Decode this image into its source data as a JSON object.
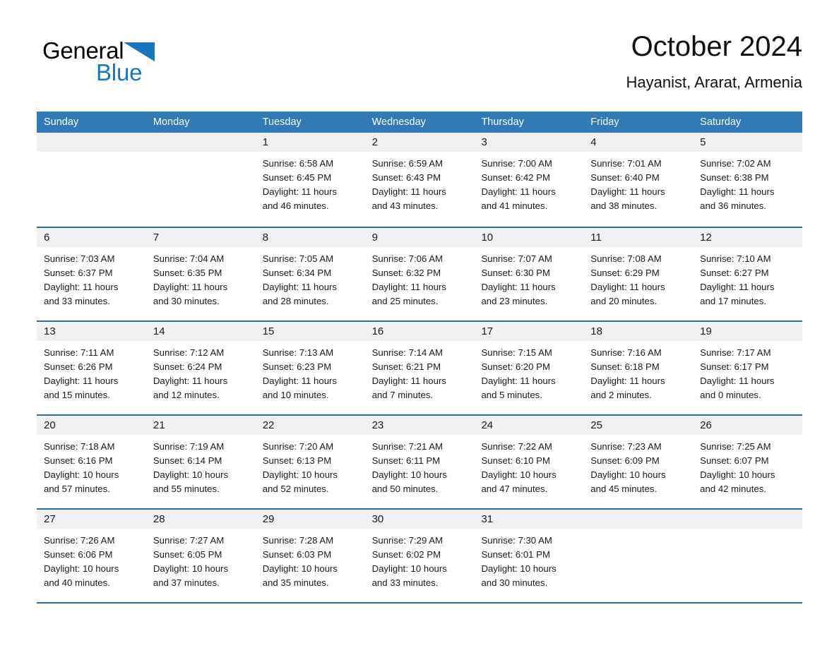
{
  "brand": {
    "name_part1": "General",
    "name_part2": "Blue",
    "triangle_color": "#1a76bc",
    "accent_color": "#3279b7"
  },
  "header": {
    "month_title": "October 2024",
    "location": "Hayanist, Ararat, Armenia"
  },
  "calendar": {
    "weekday_headers": [
      "Sunday",
      "Monday",
      "Tuesday",
      "Wednesday",
      "Thursday",
      "Friday",
      "Saturday"
    ],
    "weeks": [
      [
        {
          "day": "",
          "sunrise": "",
          "sunset": "",
          "daylight_line1": "",
          "daylight_line2": "",
          "empty": true
        },
        {
          "day": "",
          "sunrise": "",
          "sunset": "",
          "daylight_line1": "",
          "daylight_line2": "",
          "empty": true
        },
        {
          "day": "1",
          "sunrise": "Sunrise: 6:58 AM",
          "sunset": "Sunset: 6:45 PM",
          "daylight_line1": "Daylight: 11 hours",
          "daylight_line2": "and 46 minutes."
        },
        {
          "day": "2",
          "sunrise": "Sunrise: 6:59 AM",
          "sunset": "Sunset: 6:43 PM",
          "daylight_line1": "Daylight: 11 hours",
          "daylight_line2": "and 43 minutes."
        },
        {
          "day": "3",
          "sunrise": "Sunrise: 7:00 AM",
          "sunset": "Sunset: 6:42 PM",
          "daylight_line1": "Daylight: 11 hours",
          "daylight_line2": "and 41 minutes."
        },
        {
          "day": "4",
          "sunrise": "Sunrise: 7:01 AM",
          "sunset": "Sunset: 6:40 PM",
          "daylight_line1": "Daylight: 11 hours",
          "daylight_line2": "and 38 minutes."
        },
        {
          "day": "5",
          "sunrise": "Sunrise: 7:02 AM",
          "sunset": "Sunset: 6:38 PM",
          "daylight_line1": "Daylight: 11 hours",
          "daylight_line2": "and 36 minutes."
        }
      ],
      [
        {
          "day": "6",
          "sunrise": "Sunrise: 7:03 AM",
          "sunset": "Sunset: 6:37 PM",
          "daylight_line1": "Daylight: 11 hours",
          "daylight_line2": "and 33 minutes."
        },
        {
          "day": "7",
          "sunrise": "Sunrise: 7:04 AM",
          "sunset": "Sunset: 6:35 PM",
          "daylight_line1": "Daylight: 11 hours",
          "daylight_line2": "and 30 minutes."
        },
        {
          "day": "8",
          "sunrise": "Sunrise: 7:05 AM",
          "sunset": "Sunset: 6:34 PM",
          "daylight_line1": "Daylight: 11 hours",
          "daylight_line2": "and 28 minutes."
        },
        {
          "day": "9",
          "sunrise": "Sunrise: 7:06 AM",
          "sunset": "Sunset: 6:32 PM",
          "daylight_line1": "Daylight: 11 hours",
          "daylight_line2": "and 25 minutes."
        },
        {
          "day": "10",
          "sunrise": "Sunrise: 7:07 AM",
          "sunset": "Sunset: 6:30 PM",
          "daylight_line1": "Daylight: 11 hours",
          "daylight_line2": "and 23 minutes."
        },
        {
          "day": "11",
          "sunrise": "Sunrise: 7:08 AM",
          "sunset": "Sunset: 6:29 PM",
          "daylight_line1": "Daylight: 11 hours",
          "daylight_line2": "and 20 minutes."
        },
        {
          "day": "12",
          "sunrise": "Sunrise: 7:10 AM",
          "sunset": "Sunset: 6:27 PM",
          "daylight_line1": "Daylight: 11 hours",
          "daylight_line2": "and 17 minutes."
        }
      ],
      [
        {
          "day": "13",
          "sunrise": "Sunrise: 7:11 AM",
          "sunset": "Sunset: 6:26 PM",
          "daylight_line1": "Daylight: 11 hours",
          "daylight_line2": "and 15 minutes."
        },
        {
          "day": "14",
          "sunrise": "Sunrise: 7:12 AM",
          "sunset": "Sunset: 6:24 PM",
          "daylight_line1": "Daylight: 11 hours",
          "daylight_line2": "and 12 minutes."
        },
        {
          "day": "15",
          "sunrise": "Sunrise: 7:13 AM",
          "sunset": "Sunset: 6:23 PM",
          "daylight_line1": "Daylight: 11 hours",
          "daylight_line2": "and 10 minutes."
        },
        {
          "day": "16",
          "sunrise": "Sunrise: 7:14 AM",
          "sunset": "Sunset: 6:21 PM",
          "daylight_line1": "Daylight: 11 hours",
          "daylight_line2": "and 7 minutes."
        },
        {
          "day": "17",
          "sunrise": "Sunrise: 7:15 AM",
          "sunset": "Sunset: 6:20 PM",
          "daylight_line1": "Daylight: 11 hours",
          "daylight_line2": "and 5 minutes."
        },
        {
          "day": "18",
          "sunrise": "Sunrise: 7:16 AM",
          "sunset": "Sunset: 6:18 PM",
          "daylight_line1": "Daylight: 11 hours",
          "daylight_line2": "and 2 minutes."
        },
        {
          "day": "19",
          "sunrise": "Sunrise: 7:17 AM",
          "sunset": "Sunset: 6:17 PM",
          "daylight_line1": "Daylight: 11 hours",
          "daylight_line2": "and 0 minutes."
        }
      ],
      [
        {
          "day": "20",
          "sunrise": "Sunrise: 7:18 AM",
          "sunset": "Sunset: 6:16 PM",
          "daylight_line1": "Daylight: 10 hours",
          "daylight_line2": "and 57 minutes."
        },
        {
          "day": "21",
          "sunrise": "Sunrise: 7:19 AM",
          "sunset": "Sunset: 6:14 PM",
          "daylight_line1": "Daylight: 10 hours",
          "daylight_line2": "and 55 minutes."
        },
        {
          "day": "22",
          "sunrise": "Sunrise: 7:20 AM",
          "sunset": "Sunset: 6:13 PM",
          "daylight_line1": "Daylight: 10 hours",
          "daylight_line2": "and 52 minutes."
        },
        {
          "day": "23",
          "sunrise": "Sunrise: 7:21 AM",
          "sunset": "Sunset: 6:11 PM",
          "daylight_line1": "Daylight: 10 hours",
          "daylight_line2": "and 50 minutes."
        },
        {
          "day": "24",
          "sunrise": "Sunrise: 7:22 AM",
          "sunset": "Sunset: 6:10 PM",
          "daylight_line1": "Daylight: 10 hours",
          "daylight_line2": "and 47 minutes."
        },
        {
          "day": "25",
          "sunrise": "Sunrise: 7:23 AM",
          "sunset": "Sunset: 6:09 PM",
          "daylight_line1": "Daylight: 10 hours",
          "daylight_line2": "and 45 minutes."
        },
        {
          "day": "26",
          "sunrise": "Sunrise: 7:25 AM",
          "sunset": "Sunset: 6:07 PM",
          "daylight_line1": "Daylight: 10 hours",
          "daylight_line2": "and 42 minutes."
        }
      ],
      [
        {
          "day": "27",
          "sunrise": "Sunrise: 7:26 AM",
          "sunset": "Sunset: 6:06 PM",
          "daylight_line1": "Daylight: 10 hours",
          "daylight_line2": "and 40 minutes."
        },
        {
          "day": "28",
          "sunrise": "Sunrise: 7:27 AM",
          "sunset": "Sunset: 6:05 PM",
          "daylight_line1": "Daylight: 10 hours",
          "daylight_line2": "and 37 minutes."
        },
        {
          "day": "29",
          "sunrise": "Sunrise: 7:28 AM",
          "sunset": "Sunset: 6:03 PM",
          "daylight_line1": "Daylight: 10 hours",
          "daylight_line2": "and 35 minutes."
        },
        {
          "day": "30",
          "sunrise": "Sunrise: 7:29 AM",
          "sunset": "Sunset: 6:02 PM",
          "daylight_line1": "Daylight: 10 hours",
          "daylight_line2": "and 33 minutes."
        },
        {
          "day": "31",
          "sunrise": "Sunrise: 7:30 AM",
          "sunset": "Sunset: 6:01 PM",
          "daylight_line1": "Daylight: 10 hours",
          "daylight_line2": "and 30 minutes."
        },
        {
          "day": "",
          "sunrise": "",
          "sunset": "",
          "daylight_line1": "",
          "daylight_line2": "",
          "empty": true
        },
        {
          "day": "",
          "sunrise": "",
          "sunset": "",
          "daylight_line1": "",
          "daylight_line2": "",
          "empty": true
        }
      ]
    ]
  }
}
